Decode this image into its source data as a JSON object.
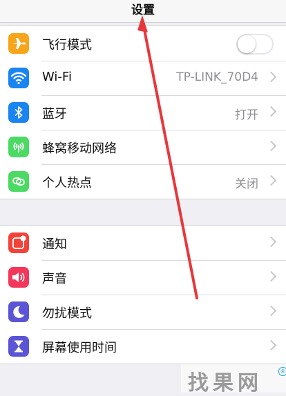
{
  "header": {
    "title": "设置"
  },
  "group1": [
    {
      "label": "飞行模式",
      "icon": "airplane-icon",
      "color": "#f7a51b",
      "control": "toggle",
      "toggle_on": false
    },
    {
      "label": "Wi-Fi",
      "icon": "wifi-icon",
      "color": "#1a84f0",
      "value": "TP-LINK_70D4"
    },
    {
      "label": "蓝牙",
      "icon": "bluetooth-icon",
      "color": "#1a84f0",
      "value": "打开"
    },
    {
      "label": "蜂窝移动网络",
      "icon": "cellular-icon",
      "color": "#4cd964",
      "value": ""
    },
    {
      "label": "个人热点",
      "icon": "hotspot-icon",
      "color": "#4cd964",
      "value": "关闭"
    }
  ],
  "group2": [
    {
      "label": "通知",
      "icon": "notifications-icon",
      "color": "#f2433a"
    },
    {
      "label": "声音",
      "icon": "sound-icon",
      "color": "#f2375a"
    },
    {
      "label": "勿扰模式",
      "icon": "moon-icon",
      "color": "#5b55d6"
    },
    {
      "label": "屏幕使用时间",
      "icon": "hourglass-icon",
      "color": "#5b55d6"
    }
  ],
  "watermark": {
    "text": "找果网",
    "badge": "®"
  }
}
